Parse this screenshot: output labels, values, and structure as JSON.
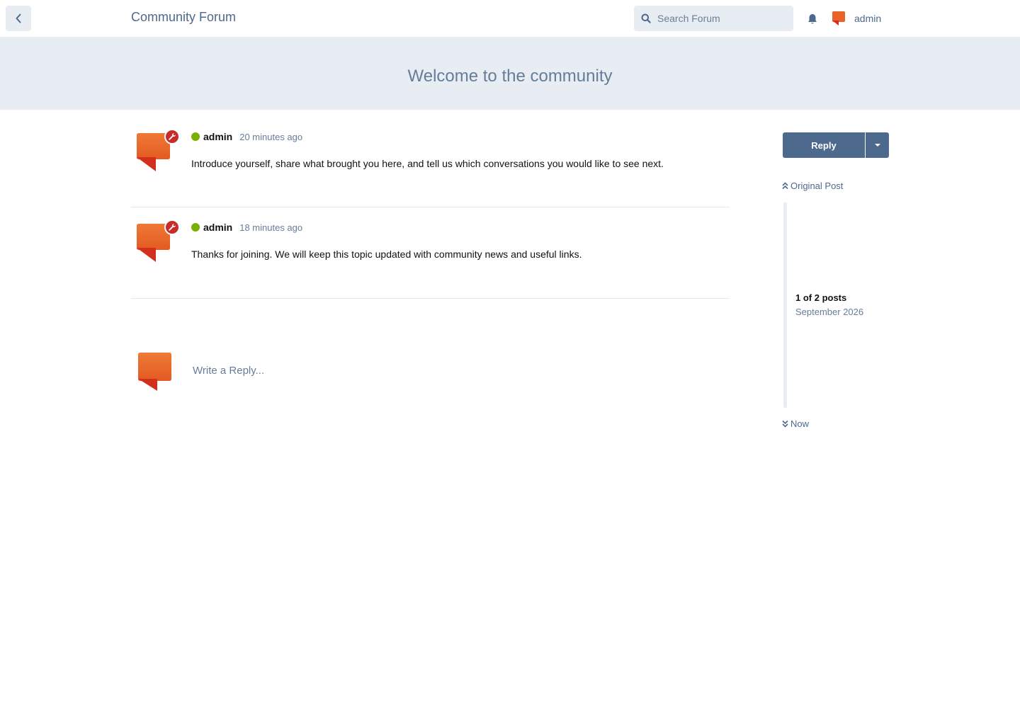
{
  "header": {
    "forum_title": "Community Forum",
    "search_placeholder": "Search Forum",
    "username": "admin"
  },
  "hero": {
    "title": "Welcome to the community"
  },
  "posts": [
    {
      "author": "admin",
      "time": "20 minutes ago",
      "body": "Introduce yourself, share what brought you here, and tell us which conversations you would like to see next."
    },
    {
      "author": "admin",
      "time": "18 minutes ago",
      "body": "Thanks for joining. We will keep this topic updated with community news and useful links."
    }
  ],
  "composer": {
    "placeholder": "Write a Reply..."
  },
  "sidebar": {
    "reply_label": "Reply",
    "original_post_label": "Original Post",
    "post_count": "1 of 2 posts",
    "date": "September 2026",
    "now_label": "Now"
  },
  "colors": {
    "accent": "#4d698e",
    "hero_bg": "#e8ecf3",
    "avatar_orange": "#e9622a",
    "mod_badge": "#c92a2a",
    "online": "#78b000"
  },
  "icons": [
    "back-chevron-icon",
    "search-icon",
    "bell-icon",
    "wrench-icon",
    "caret-down-icon",
    "double-chevron-up-icon",
    "double-chevron-down-icon"
  ]
}
